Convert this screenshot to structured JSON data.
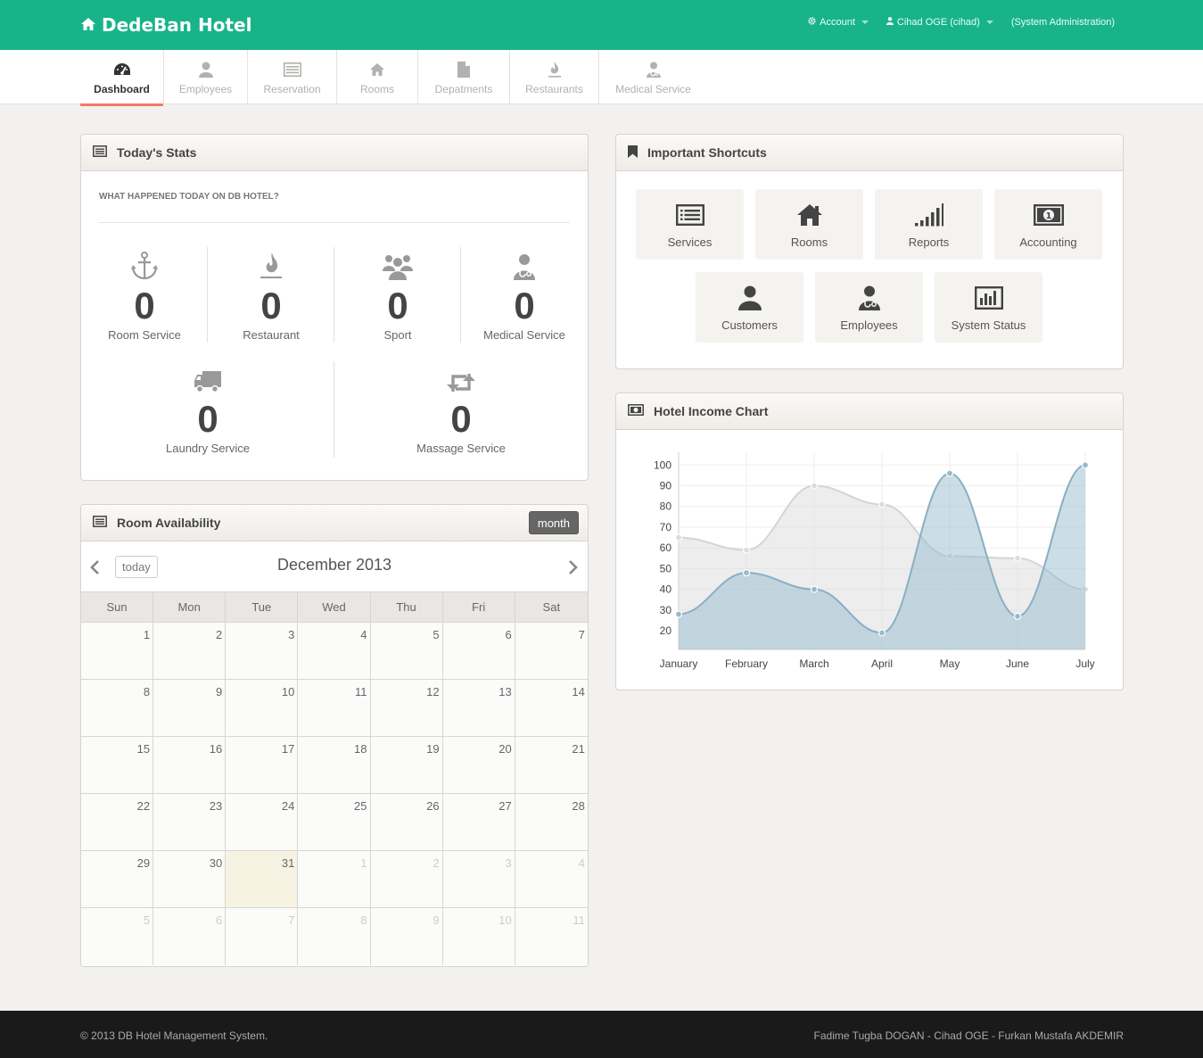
{
  "app": {
    "title": "DedeBan Hotel"
  },
  "topnav": {
    "account": "Account",
    "user": "Cihad OGE (cihad)",
    "role": "(System Administration)"
  },
  "tabs": [
    {
      "label": "Dashboard",
      "icon": "dashboard-icon"
    },
    {
      "label": "Employees",
      "icon": "user-icon"
    },
    {
      "label": "Reservation",
      "icon": "list-icon"
    },
    {
      "label": "Rooms",
      "icon": "home-icon"
    },
    {
      "label": "Depatments",
      "icon": "file-icon"
    },
    {
      "label": "Restaurants",
      "icon": "fire-icon"
    },
    {
      "label": "Medical Service",
      "icon": "doctor-icon"
    }
  ],
  "stats": {
    "title": "Today's Stats",
    "subtitle": "WHAT HAPPENED TODAY ON DB HOTEL?",
    "items": [
      {
        "label": "Room Service",
        "value": "0",
        "icon": "anchor-icon"
      },
      {
        "label": "Restaurant",
        "value": "0",
        "icon": "fire-icon"
      },
      {
        "label": "Sport",
        "value": "0",
        "icon": "group-icon"
      },
      {
        "label": "Medical Service",
        "value": "0",
        "icon": "doctor-icon"
      },
      {
        "label": "Laundry Service",
        "value": "0",
        "icon": "truck-icon"
      },
      {
        "label": "Massage Service",
        "value": "0",
        "icon": "retweet-icon"
      }
    ]
  },
  "shortcuts": {
    "title": "Important Shortcuts",
    "items": [
      {
        "label": "Services",
        "icon": "list-icon"
      },
      {
        "label": "Rooms",
        "icon": "home-icon"
      },
      {
        "label": "Reports",
        "icon": "signal-icon"
      },
      {
        "label": "Accounting",
        "icon": "money-icon"
      },
      {
        "label": "Customers",
        "icon": "user-icon"
      },
      {
        "label": "Employees",
        "icon": "doctor-icon"
      },
      {
        "label": "System Status",
        "icon": "bar-chart-icon"
      }
    ]
  },
  "calendar": {
    "title": "Room Availability",
    "view_button": "month",
    "today_button": "today",
    "month_title": "December 2013",
    "weekdays": [
      "Sun",
      "Mon",
      "Tue",
      "Wed",
      "Thu",
      "Fri",
      "Sat"
    ],
    "weeks": [
      [
        "1",
        "2",
        "3",
        "4",
        "5",
        "6",
        "7"
      ],
      [
        "8",
        "9",
        "10",
        "11",
        "12",
        "13",
        "14"
      ],
      [
        "15",
        "16",
        "17",
        "18",
        "19",
        "20",
        "21"
      ],
      [
        "22",
        "23",
        "24",
        "25",
        "26",
        "27",
        "28"
      ],
      [
        "29",
        "30",
        "31",
        "1",
        "2",
        "3",
        "4"
      ],
      [
        "5",
        "6",
        "7",
        "8",
        "9",
        "10",
        "11"
      ]
    ],
    "today": "31"
  },
  "income_chart": {
    "title": "Hotel Income Chart"
  },
  "chart_data": {
    "type": "area",
    "categories": [
      "January",
      "February",
      "March",
      "April",
      "May",
      "June",
      "July"
    ],
    "series": [
      {
        "values": [
          65,
          59,
          90,
          81,
          56,
          55,
          40
        ],
        "color": "#dcdcdc"
      },
      {
        "values": [
          28,
          48,
          40,
          19,
          96,
          27,
          100
        ],
        "color": "#97bbcd"
      }
    ],
    "yticks": [
      20,
      30,
      40,
      50,
      60,
      70,
      80,
      90,
      100
    ],
    "ylim": [
      11,
      104
    ]
  },
  "footer": {
    "copyright": "© 2013 DB Hotel Management System.",
    "authors": "Fadime Tugba DOGAN - Cihad OGE - Furkan Mustafa AKDEMIR"
  }
}
